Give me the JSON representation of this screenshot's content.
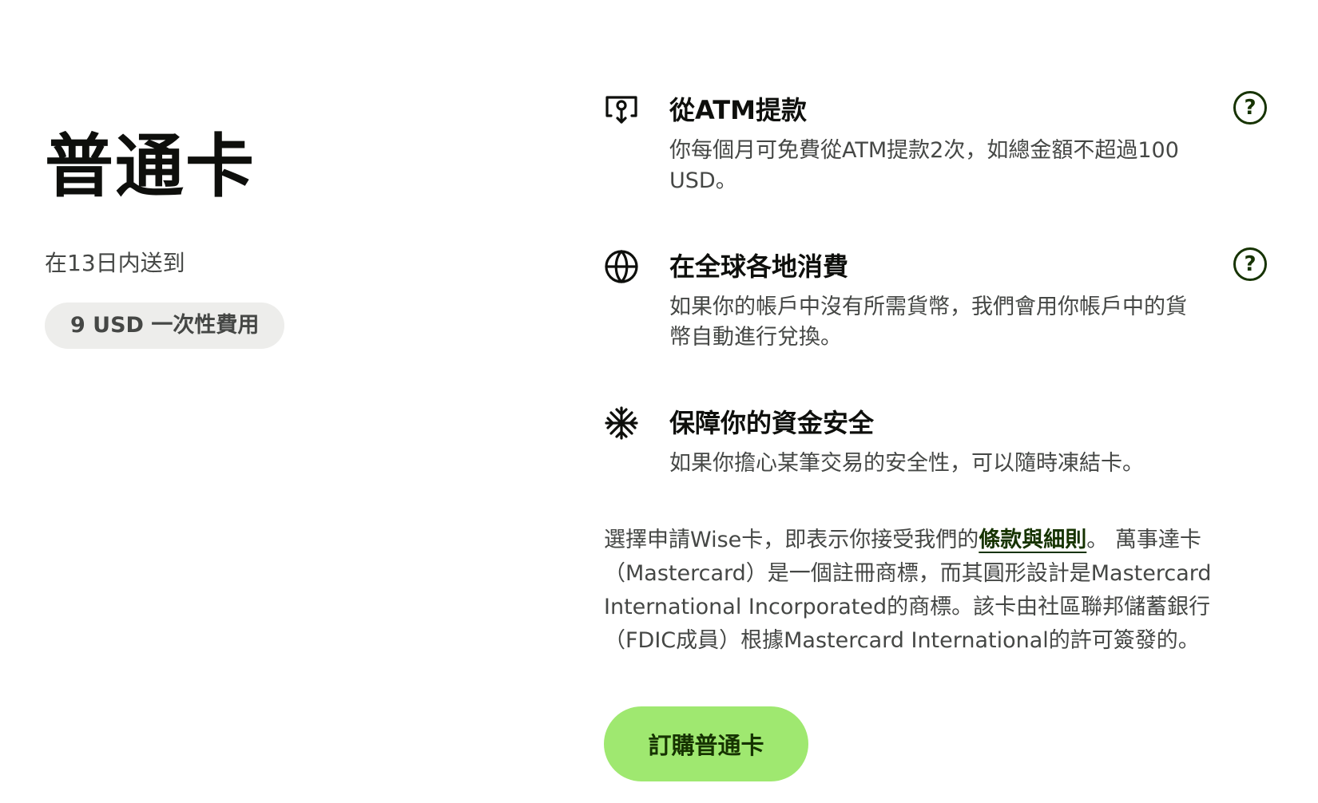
{
  "card": {
    "title": "普通卡",
    "delivery": "在13日内送到",
    "fee": "9 USD 一次性費用"
  },
  "features": [
    {
      "icon": "atm-withdraw-icon",
      "title": "從ATM提款",
      "description": "你每個月可免費從ATM提款2次，如總金額不超過100 USD。",
      "help": "?"
    },
    {
      "icon": "globe-icon",
      "title": "在全球各地消費",
      "description": "如果你的帳戶中沒有所需貨幣，我們會用你帳戶中的貨幣自動進行兌換。",
      "help": "?"
    },
    {
      "icon": "snowflake-icon",
      "title": "保障你的資金安全",
      "description": "如果你擔心某筆交易的安全性，可以隨時凍結卡。"
    }
  ],
  "legal": {
    "before_link": "選擇申請Wise卡，即表示你接受我們的",
    "link_text": "條款與細則",
    "after_link": "。 萬事達卡（Mastercard）是一個註冊商標，而其圓形設計是Mastercard International Incorporated的商標。該卡由社區聯邦儲蓄銀行（FDIC成員）根據Mastercard International的許可簽發的。"
  },
  "order_button": "訂購普通卡",
  "colors": {
    "brand_green": "#9fe870",
    "forest_green": "#163300",
    "text_primary": "#0e0f0c",
    "text_secondary": "#454745",
    "pill_bg": "#ededeb"
  }
}
